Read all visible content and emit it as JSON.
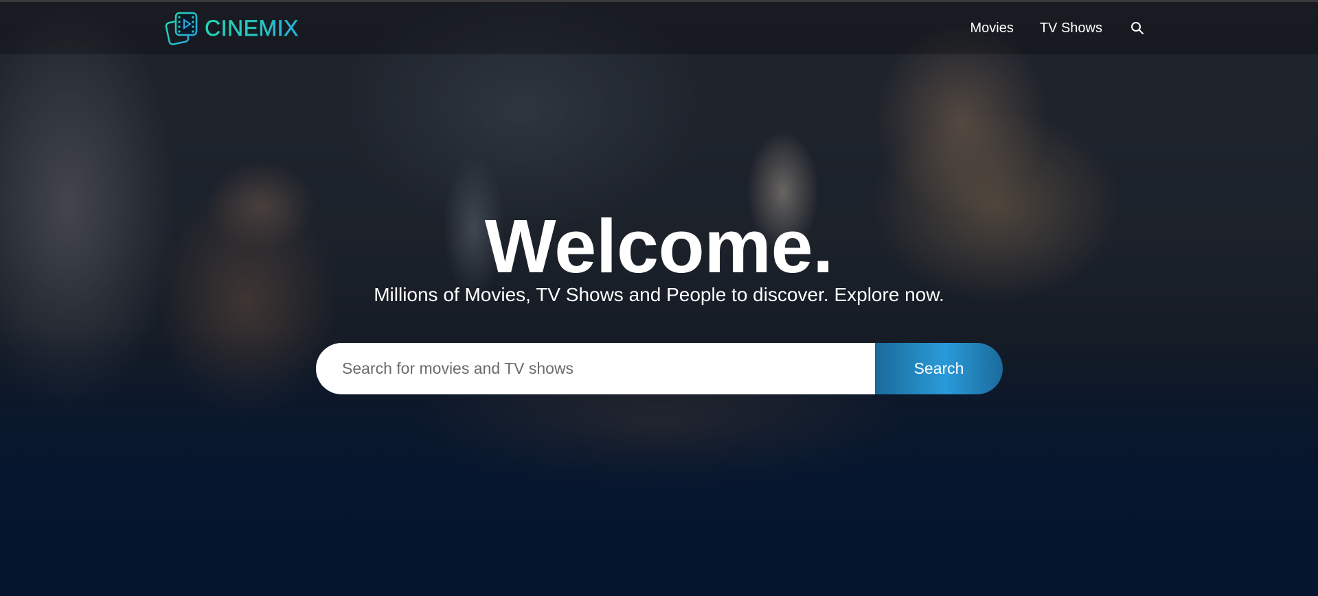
{
  "brand": {
    "name": "CINEMIX",
    "accent_colors": [
      "#24d6b0",
      "#2aa9e6"
    ]
  },
  "nav": {
    "items": [
      {
        "label": "Movies"
      },
      {
        "label": "TV Shows"
      }
    ],
    "search_icon": "search-icon"
  },
  "hero": {
    "title": "Welcome.",
    "subtitle": "Millions of Movies, TV Shows and People to discover. Explore now.",
    "search": {
      "placeholder": "Search for movies and TV shows",
      "value": "",
      "button_label": "Search"
    }
  },
  "colors": {
    "background": "#04152d",
    "search_button": "#2a9ad9"
  }
}
